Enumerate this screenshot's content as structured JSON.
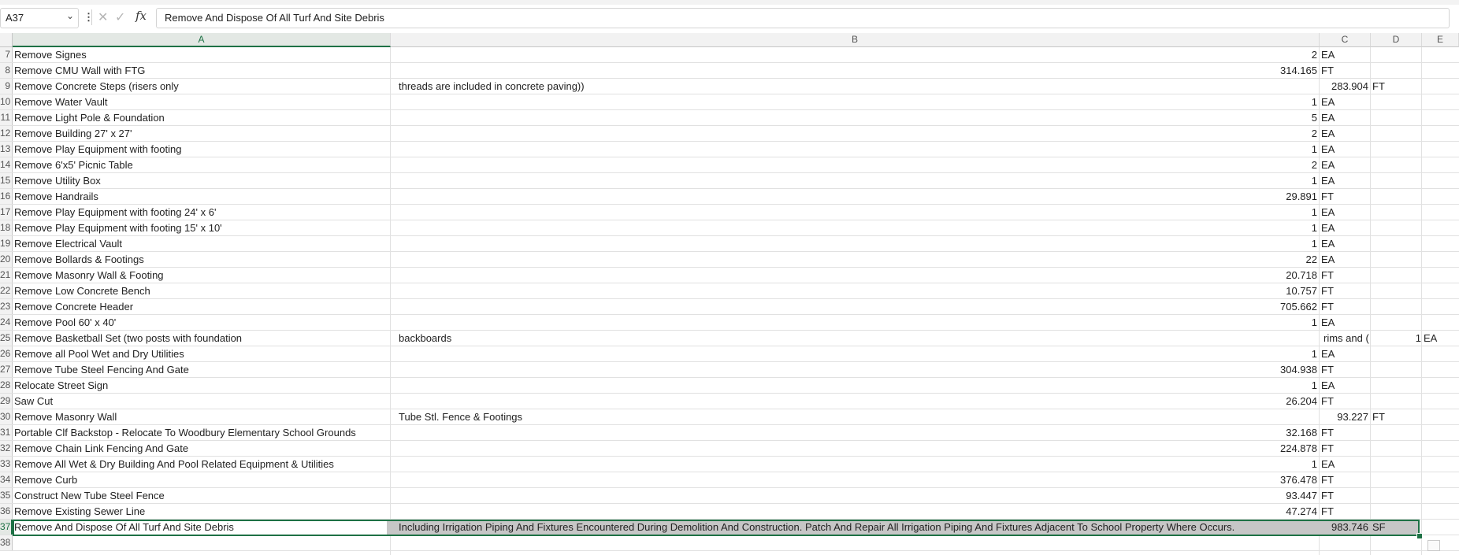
{
  "formula_bar": {
    "name_box": "A37",
    "name_box_dropdown_icon": "chevron-down",
    "cancel_icon": "x-icon",
    "enter_icon": "check-icon",
    "fx_label": "fx",
    "formula": "Remove And Dispose Of All Turf And Site Debris"
  },
  "columns": [
    "A",
    "B",
    "C",
    "D",
    "E"
  ],
  "selected_cell": "A37",
  "rows": [
    {
      "num": "7",
      "a": "Remove Signes",
      "b": "",
      "qty": "2",
      "unit": "EA"
    },
    {
      "num": "8",
      "a": "Remove CMU Wall with FTG",
      "b": "",
      "qty": "314.165",
      "unit": "FT"
    },
    {
      "num": "9",
      "a": "Remove Concrete Steps (risers only",
      "b": "threads are included in concrete paving))",
      "qty": "",
      "unit": "",
      "c_val": "283.904",
      "d_val": "FT"
    },
    {
      "num": "10",
      "a": "Remove Water Vault",
      "b": "",
      "qty": "1",
      "unit": "EA"
    },
    {
      "num": "11",
      "a": "Remove Light Pole & Foundation",
      "b": "",
      "qty": "5",
      "unit": "EA"
    },
    {
      "num": "12",
      "a": "Remove Building 27' x 27'",
      "b": "",
      "qty": "2",
      "unit": "EA"
    },
    {
      "num": "13",
      "a": "Remove Play Equipment with footing",
      "b": "",
      "qty": "1",
      "unit": "EA"
    },
    {
      "num": "14",
      "a": "Remove 6'x5' Picnic Table",
      "b": "",
      "qty": "2",
      "unit": "EA"
    },
    {
      "num": "15",
      "a": "Remove Utility Box",
      "b": "",
      "qty": "1",
      "unit": "EA"
    },
    {
      "num": "16",
      "a": "Remove Handrails",
      "b": "",
      "qty": "29.891",
      "unit": "FT"
    },
    {
      "num": "17",
      "a": "Remove Play Equipment with footing 24' x 6'",
      "b": "",
      "qty": "1",
      "unit": "EA"
    },
    {
      "num": "18",
      "a": "Remove Play Equipment with footing 15' x 10'",
      "b": "",
      "qty": "1",
      "unit": "EA"
    },
    {
      "num": "19",
      "a": "Remove Electrical Vault",
      "b": "",
      "qty": "1",
      "unit": "EA"
    },
    {
      "num": "20",
      "a": "Remove Bollards & Footings",
      "b": "",
      "qty": "22",
      "unit": "EA"
    },
    {
      "num": "21",
      "a": "Remove Masonry Wall & Footing",
      "b": "",
      "qty": "20.718",
      "unit": "FT"
    },
    {
      "num": "22",
      "a": "Remove Low Concrete Bench",
      "b": "",
      "qty": "10.757",
      "unit": "FT"
    },
    {
      "num": "23",
      "a": "Remove Concrete Header",
      "b": "",
      "qty": "705.662",
      "unit": "FT"
    },
    {
      "num": "24",
      "a": "Remove Pool 60' x 40'",
      "b": "",
      "qty": "1",
      "unit": "EA"
    },
    {
      "num": "25",
      "a": "Remove Basketball Set (two posts with foundation",
      "b": "backboards",
      "qty": "",
      "unit": "",
      "c_val": "rims and (",
      "e_val": "1",
      "e_unit": "EA"
    },
    {
      "num": "26",
      "a": "Remove all Pool Wet and Dry Utilities",
      "b": "",
      "qty": "1",
      "unit": "EA"
    },
    {
      "num": "27",
      "a": "Remove Tube Steel Fencing And Gate",
      "b": "",
      "qty": "304.938",
      "unit": "FT"
    },
    {
      "num": "28",
      "a": "Relocate Street Sign",
      "b": "",
      "qty": "1",
      "unit": "EA"
    },
    {
      "num": "29",
      "a": "Saw Cut",
      "b": "",
      "qty": "26.204",
      "unit": "FT"
    },
    {
      "num": "30",
      "a": "Remove Masonry Wall",
      "b": "Tube Stl. Fence & Footings",
      "qty": "",
      "unit": "",
      "c_val": "93.227",
      "d_val": "FT"
    },
    {
      "num": "31",
      "a": "Portable Clf Backstop - Relocate To Woodbury Elementary School Grounds",
      "b": "",
      "qty": "32.168",
      "unit": "FT"
    },
    {
      "num": "32",
      "a": "Remove Chain Link Fencing And Gate",
      "b": "",
      "qty": "224.878",
      "unit": "FT"
    },
    {
      "num": "33",
      "a": "Remove All Wet & Dry Building And Pool Related Equipment & Utilities",
      "b": "",
      "qty": "1",
      "unit": "EA"
    },
    {
      "num": "34",
      "a": "Remove Curb",
      "b": "",
      "qty": "376.478",
      "unit": "FT"
    },
    {
      "num": "35",
      "a": "Construct New Tube Steel Fence",
      "b": "",
      "qty": "93.447",
      "unit": "FT"
    },
    {
      "num": "36",
      "a": "Remove Existing Sewer Line",
      "b": "",
      "qty": "47.274",
      "unit": "FT"
    },
    {
      "num": "37",
      "a": "Remove And Dispose Of All Turf And Site Debris",
      "b": "Including Irrigation Piping And Fixtures Encountered During Demolition And Construction. Patch And Repair All Irrigation Piping And Fixtures Adjacent To School Property Where Occurs.",
      "qty": "",
      "unit": "",
      "c_val": "983.746",
      "d_val": "SF"
    },
    {
      "num": "38",
      "a": "",
      "b": "",
      "qty": "",
      "unit": ""
    }
  ],
  "colors": {
    "selection_accent": "#1e7145",
    "header_bg": "#f2f2f2",
    "gridline": "#e1e1e1",
    "selected_fill": "#c6c6c6"
  }
}
